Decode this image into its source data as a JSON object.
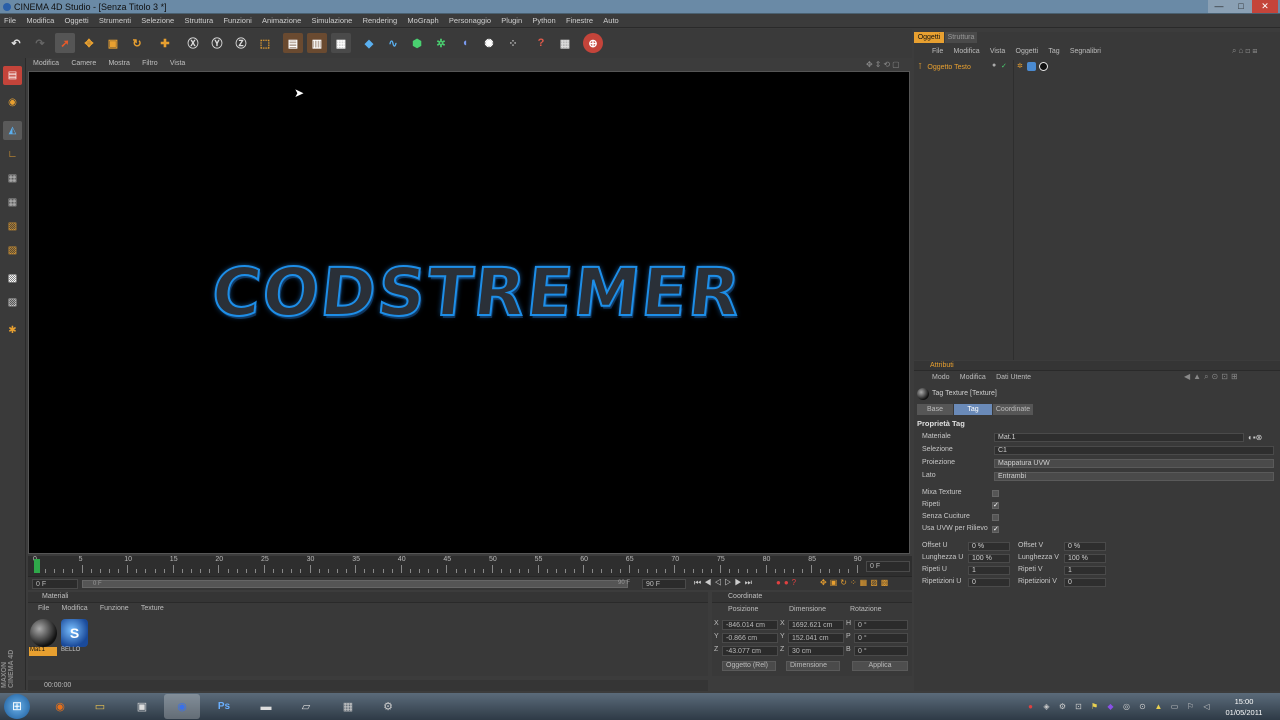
{
  "window": {
    "title": "CINEMA 4D Studio - [Senza Titolo 3 *]",
    "min": "—",
    "max": "□",
    "close": "✕"
  },
  "menubar": [
    "File",
    "Modifica",
    "Oggetti",
    "Strumenti",
    "Selezione",
    "Struttura",
    "Funzioni",
    "Animazione",
    "Simulazione",
    "Rendering",
    "MoGraph",
    "Personaggio",
    "Plugin",
    "Python",
    "Finestre",
    "Auto"
  ],
  "viewport": {
    "menu": [
      "Modifica",
      "Camere",
      "Mostra",
      "Filtro",
      "Vista"
    ],
    "text": "CODSTREMER"
  },
  "timeline": {
    "ticks": [
      "0",
      "5",
      "10",
      "15",
      "20",
      "25",
      "30",
      "35",
      "40",
      "45",
      "50",
      "55",
      "60",
      "65",
      "70",
      "75",
      "80",
      "85",
      "90"
    ],
    "current": "0 F",
    "start": "0 F",
    "range_start": "0 F",
    "range_end": "90 F",
    "end": "90 F"
  },
  "materials": {
    "header": "Materiali",
    "menu": [
      "File",
      "Modifica",
      "Funzione",
      "Texture"
    ],
    "items": [
      "Mat.1",
      "BELLO"
    ],
    "status": "00:00:00"
  },
  "coords": {
    "header": "Coordinate",
    "cols": [
      "Posizione",
      "Dimensione",
      "Rotazione"
    ],
    "rows": [
      {
        "axis": "X",
        "pos": "-846.014 cm",
        "dim_axis": "X",
        "dim": "1692.621 cm",
        "rot_axis": "H",
        "rot": "0 °"
      },
      {
        "axis": "Y",
        "pos": "-0.866 cm",
        "dim_axis": "Y",
        "dim": "152.041 cm",
        "rot_axis": "P",
        "rot": "0 °"
      },
      {
        "axis": "Z",
        "pos": "-43.077 cm",
        "dim_axis": "Z",
        "dim": "30 cm",
        "rot_axis": "B",
        "rot": "0 °"
      }
    ],
    "mode1": "Oggetto (Rel)",
    "mode2": "Dimensione",
    "apply": "Applica"
  },
  "objects": {
    "tabs": [
      "Oggetti",
      "Struttura"
    ],
    "menu": [
      "File",
      "Modifica",
      "Vista",
      "Oggetti",
      "Tag",
      "Segnalibri"
    ],
    "items": [
      {
        "name": "Oggetto Testo"
      }
    ]
  },
  "attributes": {
    "header": "Attributi",
    "menu": [
      "Modo",
      "Modifica",
      "Dati Utente"
    ],
    "title": "Tag Texture [Texture]",
    "tabs": [
      "Base",
      "Tag",
      "Coordinate"
    ],
    "section": "Proprietà Tag",
    "fields": [
      {
        "label": "Materiale",
        "value": "Mat.1"
      },
      {
        "label": "Selezione",
        "value": "C1"
      },
      {
        "label": "Proiezione",
        "value": "Mappatura UVW"
      },
      {
        "label": "Lato",
        "value": "Entrambi"
      }
    ],
    "checks": [
      {
        "label": "Mixa Texture",
        "checked": false
      },
      {
        "label": "Ripeti",
        "checked": true
      },
      {
        "label": "Senza Cuciture",
        "checked": false
      },
      {
        "label": "Usa UVW per Rilievo",
        "checked": true
      }
    ],
    "numeric": [
      {
        "l1": "Offset U",
        "v1": "0 %",
        "l2": "Offset V",
        "v2": "0 %"
      },
      {
        "l1": "Lunghezza U",
        "v1": "100 %",
        "l2": "Lunghezza V",
        "v2": "100 %"
      },
      {
        "l1": "Ripeti U",
        "v1": "1",
        "l2": "Ripeti V",
        "v2": "1"
      },
      {
        "l1": "Ripetizioni U",
        "v1": "0",
        "l2": "Ripetizioni V",
        "v2": "0"
      }
    ]
  },
  "maxon": "MAXON CINEMA 4D",
  "taskbar": {
    "time": "15:00",
    "date": "01/05/2011",
    "ps": "Ps"
  },
  "colors": {
    "accent": "#e8a030",
    "blue_outline": "#1d8ee8",
    "selected_tab": "#6a8ab8"
  }
}
